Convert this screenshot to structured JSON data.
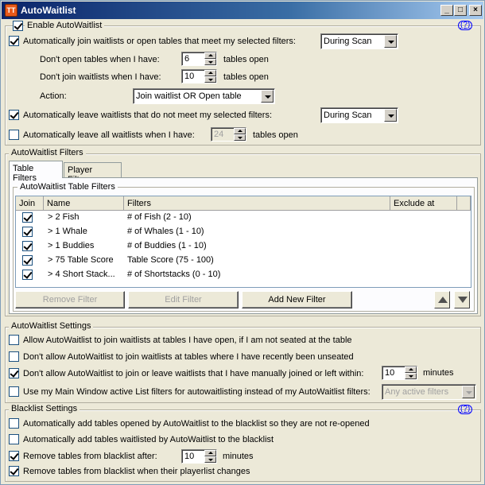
{
  "window": {
    "title": "AutoWaitlist",
    "app_icon": "TT",
    "minimize": "_",
    "maximize": "□",
    "close": "×"
  },
  "main_settings": {
    "enable_label": "Enable AutoWaitlist",
    "enable_checked": true,
    "help": "(?)",
    "auto_join_label": "Automatically join waitlists or open tables that meet my selected filters:",
    "auto_join_checked": true,
    "auto_join_when": "During Scan",
    "dont_open_label": "Don't open tables when I have:",
    "dont_open_value": "6",
    "dont_open_suffix": "tables open",
    "dont_join_label": "Don't join waitlists when I have:",
    "dont_join_value": "10",
    "dont_join_suffix": "tables open",
    "action_label": "Action:",
    "action_value": "Join waitlist OR Open table",
    "auto_leave_label": "Automatically leave waitlists that do not meet my selected filters:",
    "auto_leave_checked": true,
    "auto_leave_when": "During Scan",
    "leave_all_label": "Automatically leave all waitlists when I have:",
    "leave_all_checked": false,
    "leave_all_value": "24",
    "leave_all_suffix": "tables open"
  },
  "filters": {
    "group_title": "AutoWaitlist Filters",
    "tabs": [
      "Table Filters",
      "Player Filters"
    ],
    "table_group_title": "AutoWaitlist Table Filters",
    "columns": [
      "Join",
      "Name",
      "Filters",
      "Exclude at"
    ],
    "rows": [
      {
        "join": true,
        "name": "> 2 Fish",
        "filters": "# of Fish (2 - 10)",
        "exclude": ""
      },
      {
        "join": true,
        "name": "> 1 Whale",
        "filters": "# of Whales (1 - 10)",
        "exclude": ""
      },
      {
        "join": true,
        "name": "> 1 Buddies",
        "filters": "# of Buddies (1 - 10)",
        "exclude": ""
      },
      {
        "join": true,
        "name": "> 75 Table Score",
        "filters": "Table Score (75 - 100)",
        "exclude": ""
      },
      {
        "join": true,
        "name": "> 4 Short Stack...",
        "filters": "# of Shortstacks (0 - 10)",
        "exclude": ""
      }
    ],
    "remove_button": "Remove Filter",
    "edit_button": "Edit Filter",
    "add_button": "Add New Filter"
  },
  "settings": {
    "group_title": "AutoWaitlist Settings",
    "allow_open_label": "Allow AutoWaitlist to join waitlists at tables I have open, if I am not seated at the table",
    "allow_open_checked": false,
    "dont_unseated_label": "Don't allow AutoWaitlist to join waitlists at tables where I have recently been unseated",
    "dont_unseated_checked": false,
    "dont_manual_label": "Don't allow  AutoWaitlist to join or leave waitlists that I have manually joined or left within:",
    "dont_manual_checked": true,
    "dont_manual_value": "10",
    "dont_manual_suffix": "minutes",
    "use_main_label": "Use my Main Window active List filters for autowaitlisting instead of my AutoWaitlist filters:",
    "use_main_checked": false,
    "use_main_select": "Any active filters"
  },
  "blacklist": {
    "group_title": "Blacklist Settings",
    "help": "(?)",
    "auto_add_opened_label": "Automatically add tables opened by AutoWaitlist to the blacklist so they are not re-opened",
    "auto_add_opened_checked": false,
    "auto_add_waitlisted_label": "Automatically add tables waitlisted by AutoWaitlist to the blacklist",
    "auto_add_waitlisted_checked": false,
    "remove_after_label": "Remove tables from blacklist after:",
    "remove_after_checked": true,
    "remove_after_value": "10",
    "remove_after_suffix": "minutes",
    "remove_playerlist_label": "Remove tables from blacklist when their playerlist changes",
    "remove_playerlist_checked": true
  }
}
